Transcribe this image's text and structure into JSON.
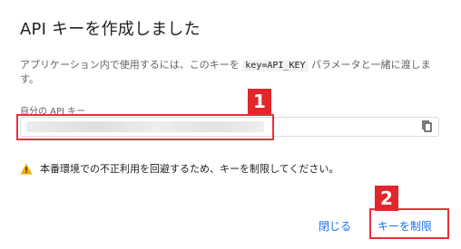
{
  "dialog": {
    "title": "API キーを作成しました",
    "description_before": "アプリケーション内で使用するには、このキーを ",
    "description_code": "key=API_KEY",
    "description_after": " パラメータと一緒に渡します。",
    "field_label": "自分の API キー",
    "field_value": "",
    "warning": "本番環境での不正利用を回避するため、キーを制限してください。",
    "buttons": {
      "close": "閉じる",
      "restrict": "キーを制限"
    }
  },
  "annotations": {
    "badge_1": "1",
    "badge_2": "2",
    "highlight_color": "#e8303a"
  },
  "colors": {
    "link_blue": "#1a73e8",
    "warning_yellow": "#f9ab00",
    "badge_red": "#e3252c"
  },
  "icons": {
    "copy": "copy-icon",
    "warning": "warning-icon"
  }
}
